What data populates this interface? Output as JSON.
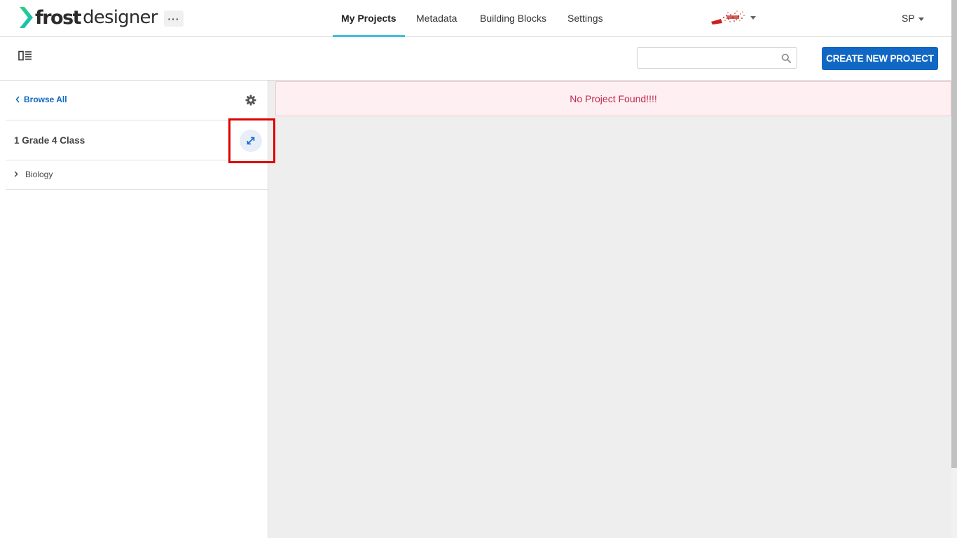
{
  "app": {
    "logo_frost": "frost",
    "logo_designer": "designer",
    "more_label": "···"
  },
  "nav": {
    "items": [
      {
        "label": "My Projects",
        "active": true
      },
      {
        "label": "Metadata",
        "active": false
      },
      {
        "label": "Building Blocks",
        "active": false
      },
      {
        "label": "Settings",
        "active": false
      }
    ],
    "brand_icon": "organization-logo",
    "user_initials": "SP"
  },
  "toolbar": {
    "layout_toggle_icon": "layout-toggle-icon",
    "search_placeholder": "",
    "search_value": "",
    "create_label": "CREATE NEW PROJECT"
  },
  "sidebar": {
    "browse_all_label": "Browse All",
    "class_title": "1 Grade 4 Class",
    "subjects": [
      {
        "label": "Biology"
      }
    ]
  },
  "main": {
    "alert_text": "No Project Found!!!!"
  },
  "colors": {
    "primary": "#1168c4",
    "accent_teal": "#3fc3d8",
    "alert_text": "#c0284e",
    "alert_bg": "#fdeff2",
    "logo_green": "#19c98a"
  }
}
